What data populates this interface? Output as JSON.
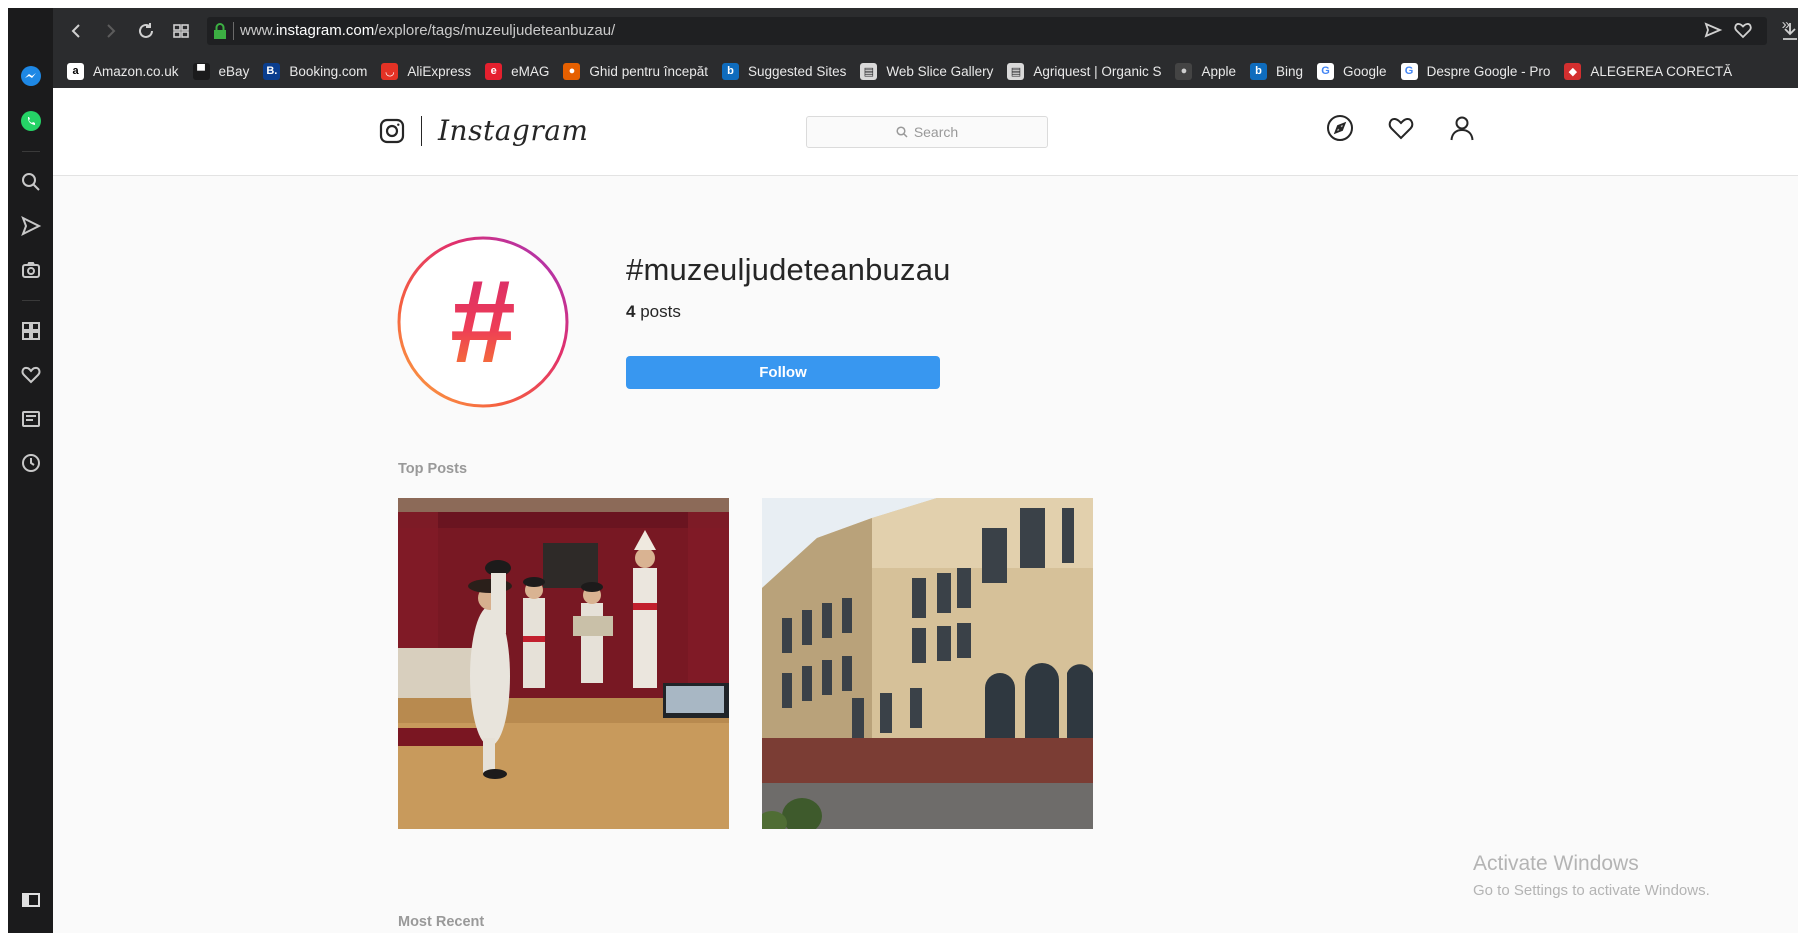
{
  "browser": {
    "url_prefix": "www.",
    "url_domain": "instagram.com",
    "url_path": "/explore/tags/muzeuljudeteanbuzau/",
    "bookmarks": [
      {
        "label": "Amazon.co.uk",
        "icon": "amazon-icon",
        "color": "#ffffff",
        "fg": "#000000",
        "glyph": "a"
      },
      {
        "label": "eBay",
        "icon": "ebay-icon",
        "color": "#1b1b1c",
        "fg": "#ffffff",
        "glyph": "▀"
      },
      {
        "label": "Booking.com",
        "icon": "booking-icon",
        "color": "#0a3e8f",
        "fg": "#ffffff",
        "glyph": "B."
      },
      {
        "label": "AliExpress",
        "icon": "aliexpress-icon",
        "color": "#e43225",
        "fg": "#ffffff",
        "glyph": "◡"
      },
      {
        "label": "eMAG",
        "icon": "emag-icon",
        "color": "#e5202e",
        "fg": "#ffffff",
        "glyph": "e"
      },
      {
        "label": "Ghid pentru începăt",
        "icon": "firefox-icon",
        "color": "#e66000",
        "fg": "#ffffff",
        "glyph": "●"
      },
      {
        "label": "Suggested Sites",
        "icon": "bing-icon",
        "color": "#0f6cbd",
        "fg": "#ffffff",
        "glyph": "b"
      },
      {
        "label": "Web Slice Gallery",
        "icon": "page-icon",
        "color": "#d9d9d9",
        "fg": "#2b2c2e",
        "glyph": "▤"
      },
      {
        "label": "Agriquest | Organic S",
        "icon": "page-icon",
        "color": "#d9d9d9",
        "fg": "#2b2c2e",
        "glyph": "▤"
      },
      {
        "label": "Apple",
        "icon": "apple-icon",
        "color": "#444444",
        "fg": "#cfcfcf",
        "glyph": "●"
      },
      {
        "label": "Bing",
        "icon": "bing-icon",
        "color": "#0f6cbd",
        "fg": "#ffffff",
        "glyph": "b"
      },
      {
        "label": "Google",
        "icon": "google-icon",
        "color": "#ffffff",
        "fg": "#4285f4",
        "glyph": "G"
      },
      {
        "label": "Despre Google - Pro",
        "icon": "google-icon",
        "color": "#ffffff",
        "fg": "#4285f4",
        "glyph": "G"
      },
      {
        "label": "ALEGEREA CORECTĂ",
        "icon": "alegerea-icon",
        "color": "#d32f2f",
        "fg": "#ffffff",
        "glyph": "◆"
      }
    ],
    "more_label": "»"
  },
  "instagram": {
    "wordmark": "Instagram",
    "search_placeholder": "Search",
    "tag": {
      "title": "#muzeuljudeteanbuzau",
      "posts_count": "4",
      "posts_word": "posts",
      "follow_label": "Follow",
      "hash_glyph": "#"
    },
    "sections": {
      "top_posts": "Top Posts",
      "most_recent": "Most Recent"
    },
    "colors": {
      "follow": "#3897f0",
      "ring_start": "#c13584",
      "ring_end": "#fcaf45"
    }
  },
  "watermark": {
    "line1": "Activate Windows",
    "line2": "Go to Settings to activate Windows."
  }
}
